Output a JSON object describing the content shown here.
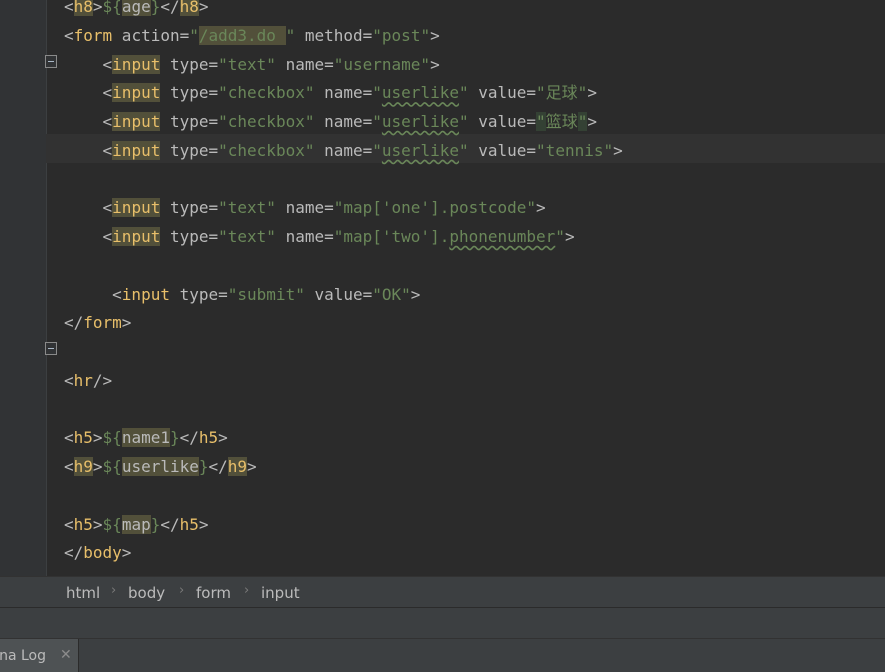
{
  "editor": {
    "lines": [
      {
        "id": "h8",
        "tokens": [
          {
            "c": "a",
            "v": "<"
          },
          {
            "c": "t hl",
            "v": "h8"
          },
          {
            "c": "a",
            "v": ">"
          },
          {
            "c": "s",
            "v": "${"
          },
          {
            "c": "a hl",
            "v": "age"
          },
          {
            "c": "s",
            "v": "}"
          },
          {
            "c": "a",
            "v": "</"
          },
          {
            "c": "t hl",
            "v": "h8"
          },
          {
            "c": "a",
            "v": ">"
          }
        ]
      },
      {
        "id": "form-open",
        "tokens": [
          {
            "c": "a",
            "v": "<"
          },
          {
            "c": "t",
            "v": "form"
          },
          {
            "c": "a",
            "v": " action="
          },
          {
            "c": "s",
            "v": "\""
          },
          {
            "c": "s hl",
            "v": "/add3.do "
          },
          {
            "c": "s",
            "v": "\""
          },
          {
            "c": "a",
            "v": " method="
          },
          {
            "c": "s",
            "v": "\"post\""
          },
          {
            "c": "a",
            "v": ">"
          }
        ]
      },
      {
        "id": "input-username",
        "tokens": [
          {
            "c": "a",
            "v": "    <"
          },
          {
            "c": "t hl",
            "v": "input"
          },
          {
            "c": "a",
            "v": " type="
          },
          {
            "c": "s",
            "v": "\"text\""
          },
          {
            "c": "a",
            "v": " name="
          },
          {
            "c": "s",
            "v": "\"username\""
          },
          {
            "c": "a",
            "v": ">"
          }
        ]
      },
      {
        "id": "input-football",
        "tokens": [
          {
            "c": "a",
            "v": "    <"
          },
          {
            "c": "t hl",
            "v": "input"
          },
          {
            "c": "a",
            "v": " type="
          },
          {
            "c": "s",
            "v": "\"checkbox\""
          },
          {
            "c": "a",
            "v": " name="
          },
          {
            "c": "s",
            "v": "\""
          },
          {
            "c": "s ul",
            "v": "userlike"
          },
          {
            "c": "s",
            "v": "\""
          },
          {
            "c": "a",
            "v": " value="
          },
          {
            "c": "s",
            "v": "\"足球\""
          },
          {
            "c": "a",
            "v": ">"
          }
        ]
      },
      {
        "id": "input-basketball",
        "tokens": [
          {
            "c": "a",
            "v": "    <"
          },
          {
            "c": "t hl",
            "v": "input"
          },
          {
            "c": "a",
            "v": " type="
          },
          {
            "c": "s",
            "v": "\"checkbox\""
          },
          {
            "c": "a",
            "v": " name="
          },
          {
            "c": "s",
            "v": "\""
          },
          {
            "c": "s ul",
            "v": "userlike"
          },
          {
            "c": "s",
            "v": "\""
          },
          {
            "c": "a",
            "v": " value="
          },
          {
            "c": "s hlb",
            "v": "\""
          },
          {
            "c": "s",
            "v": "篮球"
          },
          {
            "c": "s hlb",
            "v": "\""
          },
          {
            "c": "a",
            "v": ">"
          }
        ]
      },
      {
        "id": "input-tennis",
        "tokens": [
          {
            "c": "a",
            "v": "    <"
          },
          {
            "c": "t hl",
            "v": "input"
          },
          {
            "c": "a",
            "v": " type="
          },
          {
            "c": "s",
            "v": "\"checkbox\""
          },
          {
            "c": "a",
            "v": " name="
          },
          {
            "c": "s",
            "v": "\""
          },
          {
            "c": "s ul",
            "v": "userlike"
          },
          {
            "c": "s",
            "v": "\""
          },
          {
            "c": "a",
            "v": " value="
          },
          {
            "c": "s",
            "v": "\"tennis\""
          },
          {
            "c": "a",
            "v": ">"
          }
        ]
      },
      {
        "id": "blank-1",
        "tokens": []
      },
      {
        "id": "input-postcode",
        "tokens": [
          {
            "c": "a",
            "v": "    <"
          },
          {
            "c": "t hl",
            "v": "input"
          },
          {
            "c": "a",
            "v": " type="
          },
          {
            "c": "s",
            "v": "\"text\""
          },
          {
            "c": "a",
            "v": " name="
          },
          {
            "c": "s",
            "v": "\"map['one'].postcode\""
          },
          {
            "c": "a",
            "v": ">"
          }
        ]
      },
      {
        "id": "input-phonenumber",
        "tokens": [
          {
            "c": "a",
            "v": "    <"
          },
          {
            "c": "t hl",
            "v": "input"
          },
          {
            "c": "a",
            "v": " type="
          },
          {
            "c": "s",
            "v": "\"text\""
          },
          {
            "c": "a",
            "v": " name="
          },
          {
            "c": "s",
            "v": "\"map['two']."
          },
          {
            "c": "s ul",
            "v": "phonenumber"
          },
          {
            "c": "s",
            "v": "\""
          },
          {
            "c": "a",
            "v": ">"
          }
        ]
      },
      {
        "id": "blank-2",
        "tokens": []
      },
      {
        "id": "input-submit",
        "tokens": [
          {
            "c": "a",
            "v": "     <"
          },
          {
            "c": "t",
            "v": "input"
          },
          {
            "c": "a",
            "v": " type="
          },
          {
            "c": "s",
            "v": "\"submit\""
          },
          {
            "c": "a",
            "v": " value="
          },
          {
            "c": "s",
            "v": "\"OK\""
          },
          {
            "c": "a",
            "v": ">"
          }
        ]
      },
      {
        "id": "form-close",
        "tokens": [
          {
            "c": "a",
            "v": "</"
          },
          {
            "c": "t",
            "v": "form"
          },
          {
            "c": "a",
            "v": ">"
          }
        ]
      },
      {
        "id": "blank-3",
        "tokens": []
      },
      {
        "id": "hr",
        "tokens": [
          {
            "c": "a",
            "v": "<"
          },
          {
            "c": "t",
            "v": "hr"
          },
          {
            "c": "a",
            "v": "/>"
          }
        ]
      },
      {
        "id": "blank-4",
        "tokens": []
      },
      {
        "id": "h5-name1",
        "tokens": [
          {
            "c": "a",
            "v": "<"
          },
          {
            "c": "t",
            "v": "h5"
          },
          {
            "c": "a",
            "v": ">"
          },
          {
            "c": "s",
            "v": "${"
          },
          {
            "c": "a hl",
            "v": "name1"
          },
          {
            "c": "s",
            "v": "}"
          },
          {
            "c": "a",
            "v": "</"
          },
          {
            "c": "t",
            "v": "h5"
          },
          {
            "c": "a",
            "v": ">"
          }
        ]
      },
      {
        "id": "h9-userlike",
        "tokens": [
          {
            "c": "a",
            "v": "<"
          },
          {
            "c": "t hl",
            "v": "h9"
          },
          {
            "c": "a",
            "v": ">"
          },
          {
            "c": "s",
            "v": "${"
          },
          {
            "c": "a hl",
            "v": "userlike"
          },
          {
            "c": "s",
            "v": "}"
          },
          {
            "c": "a",
            "v": "</"
          },
          {
            "c": "t hl",
            "v": "h9"
          },
          {
            "c": "a",
            "v": ">"
          }
        ]
      },
      {
        "id": "blank-5",
        "tokens": []
      },
      {
        "id": "h5-map",
        "tokens": [
          {
            "c": "a",
            "v": "<"
          },
          {
            "c": "t",
            "v": "h5"
          },
          {
            "c": "a",
            "v": ">"
          },
          {
            "c": "s",
            "v": "${"
          },
          {
            "c": "a hl",
            "v": "map"
          },
          {
            "c": "s",
            "v": "}"
          },
          {
            "c": "a",
            "v": "</"
          },
          {
            "c": "t",
            "v": "h5"
          },
          {
            "c": "a",
            "v": ">"
          }
        ]
      },
      {
        "id": "body-close",
        "tokens": [
          {
            "c": "a",
            "v": "</"
          },
          {
            "c": "t",
            "v": "body"
          },
          {
            "c": "a",
            "v": ">"
          }
        ]
      }
    ]
  },
  "breadcrumb": {
    "items": [
      "html",
      "body",
      "form",
      "input"
    ]
  },
  "bottom_panel": {
    "tab_label": "Tomcat Catalina Log",
    "close_glyph": "✕"
  },
  "colors": {
    "background": "#2b2b2b",
    "tag": "#e8bf6a",
    "attribute": "#bababa",
    "string": "#6a8759",
    "highlight": "#52503a"
  },
  "icons": [
    "fold-icon",
    "chevron-right-icon",
    "close-icon"
  ]
}
